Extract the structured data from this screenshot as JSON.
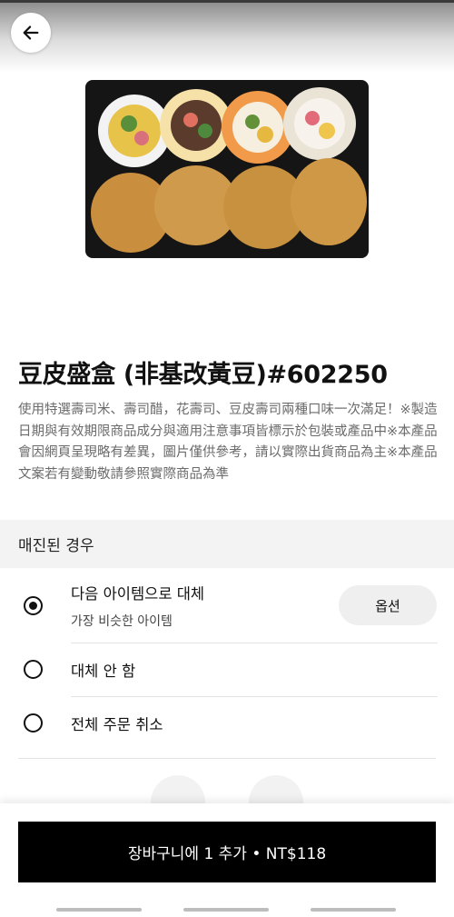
{
  "product": {
    "title": "豆皮盛盒 (非基改黃豆)#602250",
    "description": "使用特選壽司米、壽司醋，花壽司、豆皮壽司兩種口味一次滿足！※製造日期與有效期限商品成分與適用注意事項皆標示於包裝或產品中※本產品會因網頁呈現略有差異，圖片僅供參考，請以實際出貨商品為主※本產品文案若有變動敬請參照實際商品為準"
  },
  "sold_out_section": {
    "header": "매진된 경우",
    "options": [
      {
        "label": "다음 아이템으로 대체",
        "sublabel": "가장 비슷한 아이템",
        "selected": true
      },
      {
        "label": "대체 안 함",
        "selected": false
      },
      {
        "label": "전체 주문 취소",
        "selected": false
      }
    ],
    "options_button": "옵션"
  },
  "add_to_cart": {
    "label": "장바구니에 1 추가 • NT$118"
  },
  "icons": {
    "back": "arrow-left-icon"
  },
  "colors": {
    "primary": "#000000",
    "muted_text": "#6b6b6b",
    "section_bg": "#f3f3f3"
  }
}
